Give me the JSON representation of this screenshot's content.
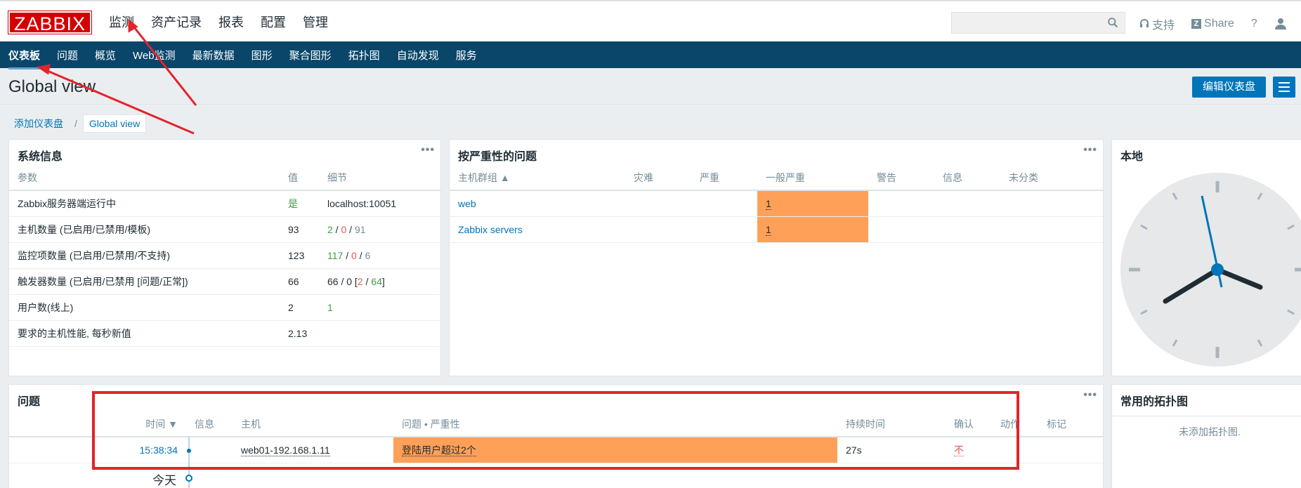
{
  "header": {
    "logo": "ZABBIX",
    "nav": [
      "监测",
      "资产记录",
      "报表",
      "配置",
      "管理"
    ],
    "search_placeholder": "",
    "support": "支持",
    "share": "Share",
    "help": "?"
  },
  "subnav": [
    "仪表板",
    "问题",
    "概览",
    "Web监测",
    "最新数据",
    "图形",
    "聚合图形",
    "拓扑图",
    "自动发现",
    "服务"
  ],
  "page": {
    "title": "Global view",
    "edit_button": "编辑仪表盘",
    "breadcrumb": [
      "添加仪表盘",
      "/",
      "Global view"
    ]
  },
  "sysinfo": {
    "title": "系统信息",
    "columns": [
      "参数",
      "值",
      "细节"
    ],
    "rows": [
      {
        "param": "Zabbix服务器端运行中",
        "value": "是",
        "detail": "localhost:10051"
      },
      {
        "param": "主机数量 (已启用/已禁用/模板)",
        "value": "93",
        "d1": "2",
        "d2": "0",
        "d3": "91"
      },
      {
        "param": "监控项数量 (已启用/已禁用/不支持)",
        "value": "123",
        "d1": "117",
        "d2": "0",
        "d3": "6"
      },
      {
        "param": "触发器数量 (已启用/已禁用 [问题/正常])",
        "value": "66",
        "d0": "66 / 0 [",
        "d1": "2",
        "d2": "64",
        "d3": "]"
      },
      {
        "param": "用户数(线上)",
        "value": "2",
        "detail": "1"
      },
      {
        "param": "要求的主机性能, 每秒新值",
        "value": "2.13",
        "detail": ""
      }
    ]
  },
  "severity": {
    "title": "按严重性的问题",
    "columns": [
      "主机群组 ▲",
      "灾难",
      "严重",
      "一般严重",
      "警告",
      "信息",
      "未分类"
    ],
    "rows": [
      {
        "group": "web",
        "average": "1"
      },
      {
        "group": "Zabbix servers",
        "average": "1"
      }
    ]
  },
  "local": {
    "title": "本地"
  },
  "problems": {
    "title": "问题",
    "columns": [
      "时间 ▼",
      "信息",
      "主机",
      "问题 • 严重性",
      "持续时间",
      "确认",
      "动作",
      "标记"
    ],
    "row": {
      "time": "15:38:34",
      "host": "web01-192.168.1.11",
      "problem": "登陆用户超过2个",
      "duration": "27s",
      "ack": "不"
    },
    "today": "今天"
  },
  "maps": {
    "title": "常用的拓扑图",
    "empty": "未添加拓扑图."
  },
  "colors": {
    "brand_red": "#d40000",
    "nav_blue": "#0a466a",
    "link_blue": "#0275b8",
    "average_orange": "#ffa059",
    "annotation_red": "#e1242c"
  }
}
